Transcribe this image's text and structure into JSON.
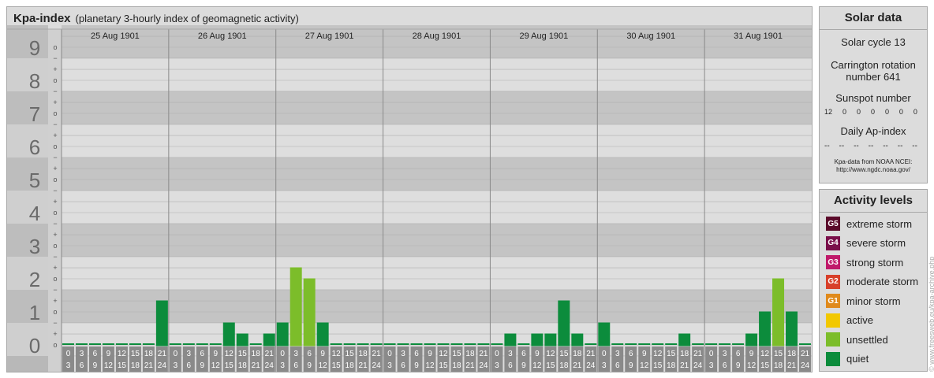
{
  "header": {
    "title": "Kpa-index",
    "subtitle": "(planetary 3-hourly index of geomagnetic activity)"
  },
  "chart_data": {
    "type": "bar",
    "ylim": [
      0,
      9
    ],
    "y_ticks": [
      "0",
      "1",
      "2",
      "3",
      "4",
      "5",
      "6",
      "7",
      "8",
      "9"
    ],
    "sub_ticks": [
      "o",
      "+",
      "−"
    ],
    "days": [
      "25 Aug 1901",
      "26 Aug 1901",
      "27 Aug 1901",
      "28 Aug 1901",
      "29 Aug 1901",
      "30 Aug 1901",
      "31 Aug 1901"
    ],
    "hour_start_labels": [
      "0",
      "3",
      "6",
      "9",
      "12",
      "15",
      "18",
      "21"
    ],
    "hour_end_labels": [
      "3",
      "6",
      "9",
      "12",
      "15",
      "18",
      "21",
      "24"
    ],
    "values": [
      [
        0,
        0,
        0,
        0,
        0,
        0,
        0,
        1.333
      ],
      [
        0,
        0,
        0,
        0,
        0.667,
        0.333,
        0,
        0.333
      ],
      [
        0.667,
        2.333,
        2,
        0.667,
        0,
        0,
        0,
        0
      ],
      [
        0,
        0,
        0,
        0,
        0,
        0,
        0,
        0
      ],
      [
        0,
        0.333,
        0,
        0.333,
        0.333,
        1.333,
        0.333,
        0
      ],
      [
        0.667,
        0,
        0,
        0,
        0,
        0,
        0.333,
        0
      ],
      [
        0,
        0,
        0,
        0.333,
        1,
        2,
        1,
        0
      ]
    ],
    "colors": {
      "quiet": "#0c8c3c",
      "unsettled": "#7cbd2a",
      "grid_band_dark": "#c4c4c4",
      "grid_band_light": "#dedede",
      "hour_cell": "#8a8a8a"
    }
  },
  "solar": {
    "heading": "Solar data",
    "cycle": "Solar cycle 13",
    "carrington_line1": "Carrington rotation",
    "carrington_line2": "number 641",
    "sunspot_heading": "Sunspot number",
    "sunspot_values": [
      "12",
      "0",
      "0",
      "0",
      "0",
      "0",
      "0"
    ],
    "ap_heading": "Daily Ap-index",
    "ap_values": [
      "--",
      "--",
      "--",
      "--",
      "--",
      "--",
      "--"
    ],
    "source_line1": "Kpa-data from NOAA NCEI:",
    "source_line2": "http://www.ngdc.noaa.gov/"
  },
  "activity": {
    "heading": "Activity levels",
    "levels": [
      {
        "badge": "G5",
        "label": "extreme storm",
        "color": "#5a0a2a"
      },
      {
        "badge": "G4",
        "label": "severe storm",
        "color": "#7a0f4a"
      },
      {
        "badge": "G3",
        "label": "strong storm",
        "color": "#c01a6a"
      },
      {
        "badge": "G2",
        "label": "moderate storm",
        "color": "#d8402a"
      },
      {
        "badge": "G1",
        "label": "minor storm",
        "color": "#e08a1c"
      },
      {
        "badge": "",
        "label": "active",
        "color": "#f2c800"
      },
      {
        "badge": "",
        "label": "unsettled",
        "color": "#7cbd2a"
      },
      {
        "badge": "",
        "label": "quiet",
        "color": "#0c8c3c"
      }
    ]
  },
  "footer": {
    "copyright": "© www.freesweb.eu/kpa-archive.php"
  }
}
